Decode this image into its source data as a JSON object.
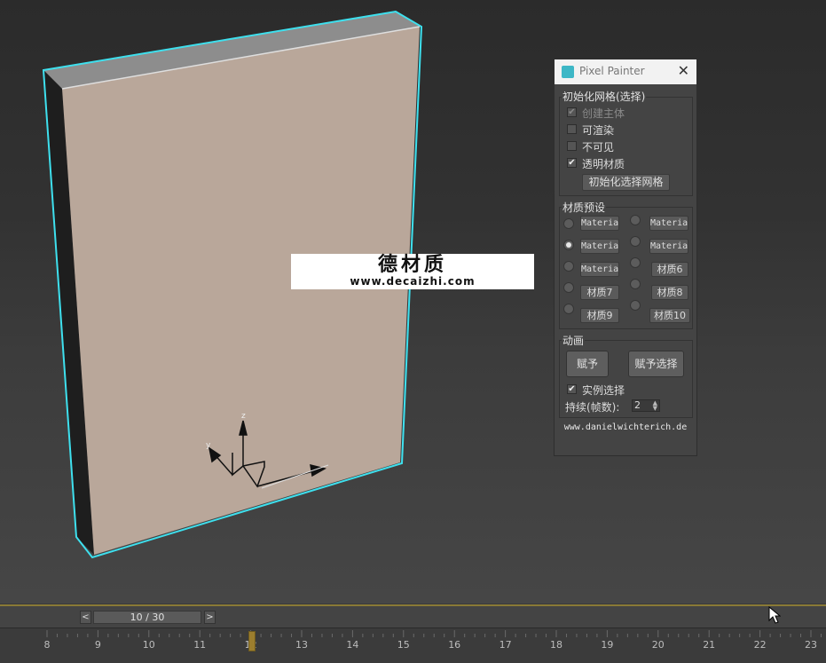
{
  "watermark": {
    "chinese": "德材质",
    "url": "www.decaizhi.com"
  },
  "gizmo": {
    "axis_z": "z",
    "axis_y": "y"
  },
  "panel": {
    "title": "Pixel Painter",
    "close_glyph": "✕",
    "init_group": {
      "label": "初始化网格(选择)",
      "options": [
        {
          "label": "创建主体",
          "checked": true,
          "disabled": true
        },
        {
          "label": "可渲染",
          "checked": false,
          "disabled": false
        },
        {
          "label": "不可见",
          "checked": false,
          "disabled": false
        },
        {
          "label": "透明材质",
          "checked": true,
          "disabled": false
        }
      ],
      "button": "初始化选择网格"
    },
    "material_group": {
      "label": "材质预设",
      "left_column": [
        {
          "label": "Materia",
          "selected": false
        },
        {
          "label": "Materia",
          "selected": true
        },
        {
          "label": "Materia",
          "selected": false
        },
        {
          "label": "材质7",
          "selected": false
        },
        {
          "label": "材质9",
          "selected": false
        }
      ],
      "right_column": [
        {
          "label": "Materia",
          "selected": false
        },
        {
          "label": "Materia",
          "selected": false
        },
        {
          "label": "材质6",
          "selected": false
        },
        {
          "label": "材质8",
          "selected": false
        },
        {
          "label": "材质10",
          "selected": false
        }
      ]
    },
    "anim_group": {
      "label": "动画",
      "assign_button": "赋予",
      "assign_selected_button": "赋予选择",
      "instance_label": "实例选择",
      "instance_checked": true,
      "duration_label": "持续(帧数):",
      "duration_value": "2"
    },
    "website": "www.danielwichterich.de"
  },
  "timeline": {
    "frame_display": "10 / 30",
    "prev_glyph": "<",
    "next_glyph": ">",
    "current_frame": 10,
    "ticks": [
      "8",
      "9",
      "10",
      "11",
      "12",
      "13",
      "14",
      "15",
      "16",
      "17",
      "18",
      "19",
      "20",
      "21",
      "22",
      "23"
    ]
  },
  "colors": {
    "selection_outline": "#3ee0ee",
    "object_front": "#b9a79a",
    "timeline_accent": "#8a7a36"
  }
}
